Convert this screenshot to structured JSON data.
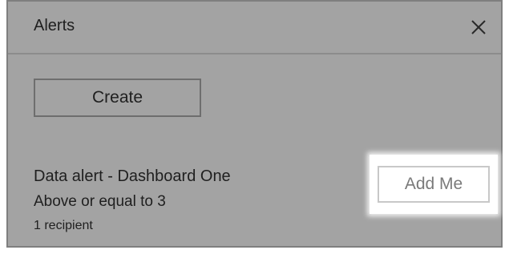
{
  "dialog": {
    "title": "Alerts",
    "close_icon": "close-icon"
  },
  "toolbar": {
    "create_label": "Create"
  },
  "alert": {
    "title": "Data alert - Dashboard One",
    "condition": "Above or equal to 3",
    "recipients": "1 recipient",
    "add_me_label": "Add Me"
  },
  "colors": {
    "panel_bg": "#a3a3a3",
    "highlight_bg": "#ffffff",
    "text": "#1f1f1f",
    "disabled_text": "#7a7a7a"
  }
}
